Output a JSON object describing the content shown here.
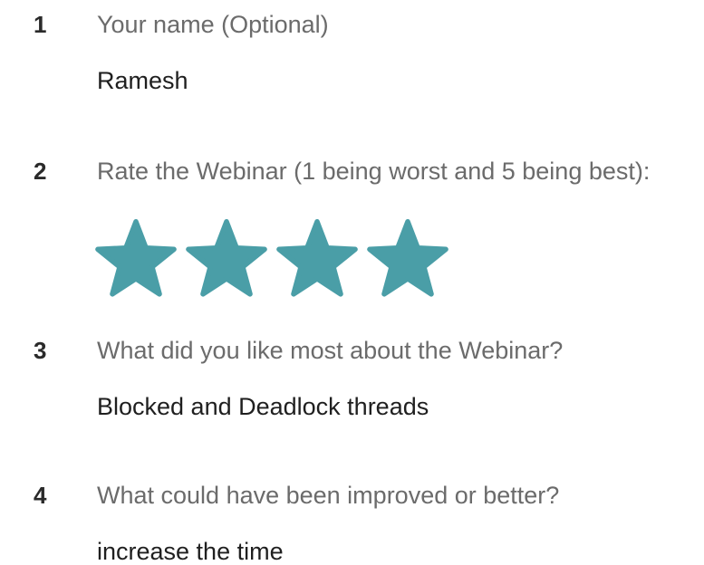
{
  "questions": [
    {
      "number": "1",
      "label": "Your name (Optional)",
      "answer": "Ramesh"
    },
    {
      "number": "2",
      "label": "Rate the Webinar (1 being worst and 5 being best):",
      "rating": {
        "value": 4,
        "max": 5
      }
    },
    {
      "number": "3",
      "label": "What did you like most about the Webinar?",
      "answer": "Blocked and Deadlock threads"
    },
    {
      "number": "4",
      "label": "What could have been improved or better?",
      "answer": "increase the time"
    }
  ],
  "colors": {
    "star_fill": "#4a9ea7"
  },
  "icons": {
    "rating_star": "star-icon"
  }
}
